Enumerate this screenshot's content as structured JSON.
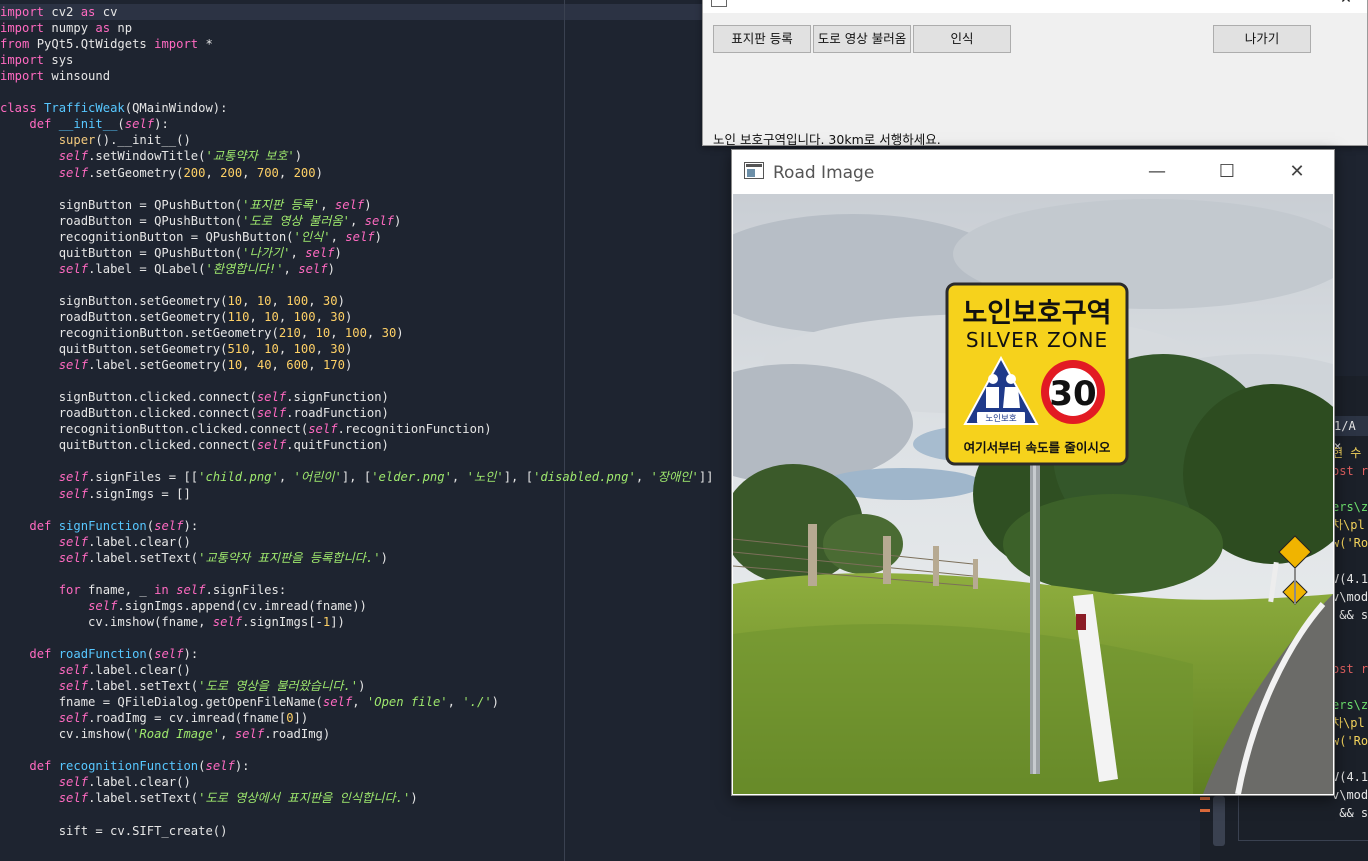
{
  "editor": {
    "lines": [
      [
        [
          "kw",
          "import"
        ],
        [
          "pl",
          " cv2 "
        ],
        [
          "kw",
          "as"
        ],
        [
          "pl",
          " cv"
        ]
      ],
      [
        [
          "kw",
          "import"
        ],
        [
          "pl",
          " numpy "
        ],
        [
          "kw",
          "as"
        ],
        [
          "pl",
          " np"
        ]
      ],
      [
        [
          "kw",
          "from"
        ],
        [
          "pl",
          " PyQt5.QtWidgets "
        ],
        [
          "kw",
          "import"
        ],
        [
          "pl",
          " *"
        ]
      ],
      [
        [
          "kw",
          "import"
        ],
        [
          "pl",
          " sys"
        ]
      ],
      [
        [
          "kw",
          "import"
        ],
        [
          "pl",
          " winsound"
        ]
      ],
      [],
      [
        [
          "kw",
          "class"
        ],
        [
          "pl",
          " "
        ],
        [
          "fn",
          "TrafficWeak"
        ],
        [
          "pl",
          "(QMainWindow):"
        ]
      ],
      [
        [
          "pl",
          "    "
        ],
        [
          "kw",
          "def"
        ],
        [
          "pl",
          " "
        ],
        [
          "fn",
          "__init__"
        ],
        [
          "pl",
          "("
        ],
        [
          "self",
          "self"
        ],
        [
          "pl",
          "):"
        ]
      ],
      [
        [
          "pl",
          "        "
        ],
        [
          "bi",
          "super"
        ],
        [
          "pl",
          "().__init__()"
        ]
      ],
      [
        [
          "pl",
          "        "
        ],
        [
          "self",
          "self"
        ],
        [
          "pl",
          ".setWindowTitle("
        ],
        [
          "str",
          "'교통약자 보호'"
        ],
        [
          "pl",
          ")"
        ]
      ],
      [
        [
          "pl",
          "        "
        ],
        [
          "self",
          "self"
        ],
        [
          "pl",
          ".setGeometry("
        ],
        [
          "num",
          "200"
        ],
        [
          "pl",
          ", "
        ],
        [
          "num",
          "200"
        ],
        [
          "pl",
          ", "
        ],
        [
          "num",
          "700"
        ],
        [
          "pl",
          ", "
        ],
        [
          "num",
          "200"
        ],
        [
          "pl",
          ")"
        ]
      ],
      [],
      [
        [
          "pl",
          "        signButton = QPushButton("
        ],
        [
          "str",
          "'표지판 등록'"
        ],
        [
          "pl",
          ", "
        ],
        [
          "self",
          "self"
        ],
        [
          "pl",
          ")"
        ]
      ],
      [
        [
          "pl",
          "        roadButton = QPushButton("
        ],
        [
          "str",
          "'도로 영상 불러옴'"
        ],
        [
          "pl",
          ", "
        ],
        [
          "self",
          "self"
        ],
        [
          "pl",
          ")"
        ]
      ],
      [
        [
          "pl",
          "        recognitionButton = QPushButton("
        ],
        [
          "str",
          "'인식'"
        ],
        [
          "pl",
          ", "
        ],
        [
          "self",
          "self"
        ],
        [
          "pl",
          ")"
        ]
      ],
      [
        [
          "pl",
          "        quitButton = QPushButton("
        ],
        [
          "str",
          "'나가기'"
        ],
        [
          "pl",
          ", "
        ],
        [
          "self",
          "self"
        ],
        [
          "pl",
          ")"
        ]
      ],
      [
        [
          "pl",
          "        "
        ],
        [
          "self",
          "self"
        ],
        [
          "pl",
          ".label = QLabel("
        ],
        [
          "str",
          "'환영합니다!'"
        ],
        [
          "pl",
          ", "
        ],
        [
          "self",
          "self"
        ],
        [
          "pl",
          ")"
        ]
      ],
      [],
      [
        [
          "pl",
          "        signButton.setGeometry("
        ],
        [
          "num",
          "10"
        ],
        [
          "pl",
          ", "
        ],
        [
          "num",
          "10"
        ],
        [
          "pl",
          ", "
        ],
        [
          "num",
          "100"
        ],
        [
          "pl",
          ", "
        ],
        [
          "num",
          "30"
        ],
        [
          "pl",
          ")"
        ]
      ],
      [
        [
          "pl",
          "        roadButton.setGeometry("
        ],
        [
          "num",
          "110"
        ],
        [
          "pl",
          ", "
        ],
        [
          "num",
          "10"
        ],
        [
          "pl",
          ", "
        ],
        [
          "num",
          "100"
        ],
        [
          "pl",
          ", "
        ],
        [
          "num",
          "30"
        ],
        [
          "pl",
          ")"
        ]
      ],
      [
        [
          "pl",
          "        recognitionButton.setGeometry("
        ],
        [
          "num",
          "210"
        ],
        [
          "pl",
          ", "
        ],
        [
          "num",
          "10"
        ],
        [
          "pl",
          ", "
        ],
        [
          "num",
          "100"
        ],
        [
          "pl",
          ", "
        ],
        [
          "num",
          "30"
        ],
        [
          "pl",
          ")"
        ]
      ],
      [
        [
          "pl",
          "        quitButton.setGeometry("
        ],
        [
          "num",
          "510"
        ],
        [
          "pl",
          ", "
        ],
        [
          "num",
          "10"
        ],
        [
          "pl",
          ", "
        ],
        [
          "num",
          "100"
        ],
        [
          "pl",
          ", "
        ],
        [
          "num",
          "30"
        ],
        [
          "pl",
          ")"
        ]
      ],
      [
        [
          "pl",
          "        "
        ],
        [
          "self",
          "self"
        ],
        [
          "pl",
          ".label.setGeometry("
        ],
        [
          "num",
          "10"
        ],
        [
          "pl",
          ", "
        ],
        [
          "num",
          "40"
        ],
        [
          "pl",
          ", "
        ],
        [
          "num",
          "600"
        ],
        [
          "pl",
          ", "
        ],
        [
          "num",
          "170"
        ],
        [
          "pl",
          ")"
        ]
      ],
      [],
      [
        [
          "pl",
          "        signButton.clicked.connect("
        ],
        [
          "self",
          "self"
        ],
        [
          "pl",
          ".signFunction)"
        ]
      ],
      [
        [
          "pl",
          "        roadButton.clicked.connect("
        ],
        [
          "self",
          "self"
        ],
        [
          "pl",
          ".roadFunction)"
        ]
      ],
      [
        [
          "pl",
          "        recognitionButton.clicked.connect("
        ],
        [
          "self",
          "self"
        ],
        [
          "pl",
          ".recognitionFunction)"
        ]
      ],
      [
        [
          "pl",
          "        quitButton.clicked.connect("
        ],
        [
          "self",
          "self"
        ],
        [
          "pl",
          ".quitFunction)"
        ]
      ],
      [],
      [
        [
          "pl",
          "        "
        ],
        [
          "self",
          "self"
        ],
        [
          "pl",
          ".signFiles = [["
        ],
        [
          "str",
          "'child.png'"
        ],
        [
          "pl",
          ", "
        ],
        [
          "str",
          "'어린이'"
        ],
        [
          "pl",
          "], ["
        ],
        [
          "str",
          "'elder.png'"
        ],
        [
          "pl",
          ", "
        ],
        [
          "str",
          "'노인'"
        ],
        [
          "pl",
          "], ["
        ],
        [
          "str",
          "'disabled.png'"
        ],
        [
          "pl",
          ", "
        ],
        [
          "str",
          "'장애인'"
        ],
        [
          "pl",
          "]]"
        ]
      ],
      [
        [
          "pl",
          "        "
        ],
        [
          "self",
          "self"
        ],
        [
          "pl",
          ".signImgs = []"
        ]
      ],
      [],
      [
        [
          "pl",
          "    "
        ],
        [
          "kw",
          "def"
        ],
        [
          "pl",
          " "
        ],
        [
          "fn",
          "signFunction"
        ],
        [
          "pl",
          "("
        ],
        [
          "self",
          "self"
        ],
        [
          "pl",
          "):"
        ]
      ],
      [
        [
          "pl",
          "        "
        ],
        [
          "self",
          "self"
        ],
        [
          "pl",
          ".label.clear()"
        ]
      ],
      [
        [
          "pl",
          "        "
        ],
        [
          "self",
          "self"
        ],
        [
          "pl",
          ".label.setText("
        ],
        [
          "str",
          "'교통약자 표지판을 등록합니다.'"
        ],
        [
          "pl",
          ")"
        ]
      ],
      [],
      [
        [
          "pl",
          "        "
        ],
        [
          "kw",
          "for"
        ],
        [
          "pl",
          " fname, _ "
        ],
        [
          "kw",
          "in"
        ],
        [
          "pl",
          " "
        ],
        [
          "self",
          "self"
        ],
        [
          "pl",
          ".signFiles:"
        ]
      ],
      [
        [
          "pl",
          "            "
        ],
        [
          "self",
          "self"
        ],
        [
          "pl",
          ".signImgs.append(cv.imread(fname))"
        ]
      ],
      [
        [
          "pl",
          "            cv.imshow(fname, "
        ],
        [
          "self",
          "self"
        ],
        [
          "pl",
          ".signImgs[-"
        ],
        [
          "num",
          "1"
        ],
        [
          "pl",
          "])"
        ]
      ],
      [],
      [
        [
          "pl",
          "    "
        ],
        [
          "kw",
          "def"
        ],
        [
          "pl",
          " "
        ],
        [
          "fn",
          "roadFunction"
        ],
        [
          "pl",
          "("
        ],
        [
          "self",
          "self"
        ],
        [
          "pl",
          "):"
        ]
      ],
      [
        [
          "pl",
          "        "
        ],
        [
          "self",
          "self"
        ],
        [
          "pl",
          ".label.clear()"
        ]
      ],
      [
        [
          "pl",
          "        "
        ],
        [
          "self",
          "self"
        ],
        [
          "pl",
          ".label.setText("
        ],
        [
          "str",
          "'도로 영상을 불러왔습니다.'"
        ],
        [
          "pl",
          ")"
        ]
      ],
      [
        [
          "pl",
          "        fname = QFileDialog.getOpenFileName("
        ],
        [
          "self",
          "self"
        ],
        [
          "pl",
          ", "
        ],
        [
          "str",
          "'Open file'"
        ],
        [
          "pl",
          ", "
        ],
        [
          "str",
          "'./'"
        ],
        [
          "pl",
          ")"
        ]
      ],
      [
        [
          "pl",
          "        "
        ],
        [
          "self",
          "self"
        ],
        [
          "pl",
          ".roadImg = cv.imread(fname["
        ],
        [
          "num",
          "0"
        ],
        [
          "pl",
          "])"
        ]
      ],
      [
        [
          "pl",
          "        cv.imshow("
        ],
        [
          "str",
          "'Road Image'"
        ],
        [
          "pl",
          ", "
        ],
        [
          "self",
          "self"
        ],
        [
          "pl",
          ".roadImg)"
        ]
      ],
      [],
      [
        [
          "pl",
          "    "
        ],
        [
          "kw",
          "def"
        ],
        [
          "pl",
          " "
        ],
        [
          "fn",
          "recognitionFunction"
        ],
        [
          "pl",
          "("
        ],
        [
          "self",
          "self"
        ],
        [
          "pl",
          "):"
        ]
      ],
      [
        [
          "pl",
          "        "
        ],
        [
          "self",
          "self"
        ],
        [
          "pl",
          ".label.clear()"
        ]
      ],
      [
        [
          "pl",
          "        "
        ],
        [
          "self",
          "self"
        ],
        [
          "pl",
          ".label.setText("
        ],
        [
          "str",
          "'도로 영상에서 표지판을 인식합니다.'"
        ],
        [
          "pl",
          ")"
        ]
      ],
      [],
      [
        [
          "pl",
          "        sift = cv.SIFT_create()"
        ]
      ]
    ]
  },
  "terminal": {
    "tab_label": "1/A ×",
    "lines": [
      [
        "t-y",
        "현 수"
      ],
      [
        "t-r",
        "ost r"
      ],
      [
        "t-w",
        ""
      ],
      [
        "t-g",
        "ers\\z"
      ],
      [
        "t-y",
        "차\\pl"
      ],
      [
        "t-y",
        "w('Ro"
      ],
      [
        "t-w",
        ""
      ],
      [
        "t-w",
        "V(4.1"
      ],
      [
        "t-w",
        "v\\mod"
      ],
      [
        "t-w",
        " && s"
      ],
      [
        "t-w",
        ""
      ],
      [
        "t-w",
        ""
      ],
      [
        "t-r",
        "ost r"
      ],
      [
        "t-w",
        ""
      ],
      [
        "t-g",
        "ers\\z"
      ],
      [
        "t-y",
        "차\\pl"
      ],
      [
        "t-y",
        "w('Ro"
      ],
      [
        "t-w",
        ""
      ],
      [
        "t-w",
        "V(4.1"
      ],
      [
        "t-w",
        "v\\mod"
      ],
      [
        "t-w",
        " && s"
      ]
    ]
  },
  "qt_window": {
    "buttons": {
      "sign": "표지판 등록",
      "road": "도로 영상 불러옴",
      "recognition": "인식",
      "quit": "나가기"
    },
    "controls": {
      "minimize": "—",
      "close": "✕"
    },
    "label": "노인 보호구역입니다. 30km로 서행하세요."
  },
  "road_window": {
    "title": "Road Image",
    "controls": {
      "minimize": "—",
      "maximize": "☐",
      "close": "✕"
    },
    "sign": {
      "title_ko": "노인보호구역",
      "title_en": "SILVER ZONE",
      "pictogram_label": "노인보호",
      "speed": "30",
      "bottom_text": "여기서부터 속도를 줄이시오"
    }
  }
}
